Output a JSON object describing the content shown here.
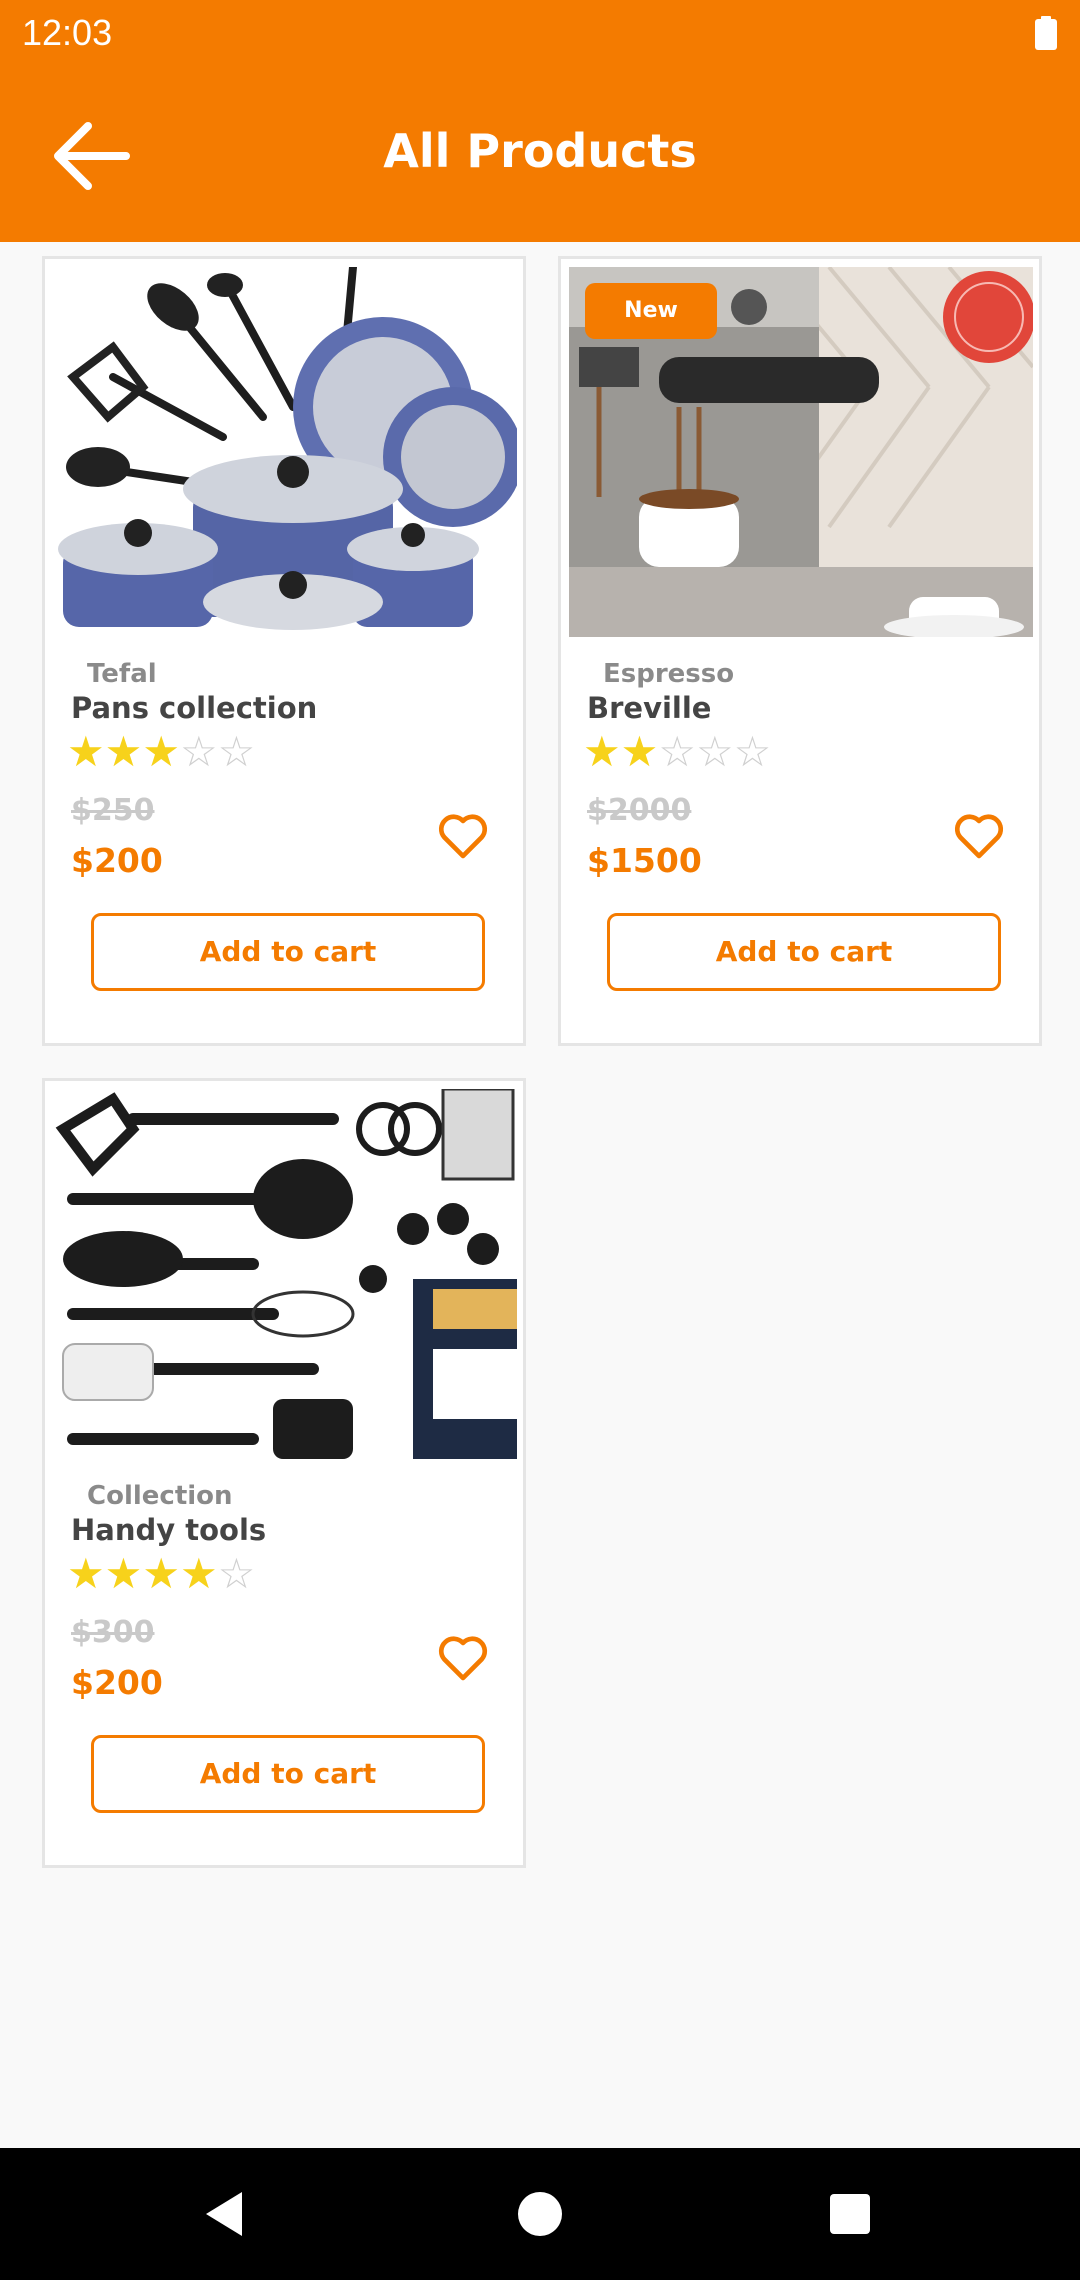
{
  "status": {
    "time": "12:03"
  },
  "appbar": {
    "title": "All Products"
  },
  "products": [
    {
      "brand": "Tefal",
      "name": "Pans collection",
      "rating": 3,
      "old_price": "$250",
      "price": "$200",
      "cta": "Add to cart",
      "badge": ""
    },
    {
      "brand": "Espresso",
      "name": "Breville",
      "rating": 2,
      "old_price": "$2000",
      "price": "$1500",
      "cta": "Add to cart",
      "badge": "New"
    },
    {
      "brand": "Collection",
      "name": "Handy tools",
      "rating": 4,
      "old_price": "$300",
      "price": "$200",
      "cta": "Add to cart",
      "badge": ""
    }
  ],
  "colors": {
    "accent": "#f47b00",
    "star": "#f7d21b"
  },
  "icons": {
    "back": "arrow-left-icon",
    "favorite": "heart-outline-icon",
    "battery": "battery-icon",
    "nav": [
      "back-triangle-icon",
      "home-circle-icon",
      "recents-square-icon"
    ]
  }
}
